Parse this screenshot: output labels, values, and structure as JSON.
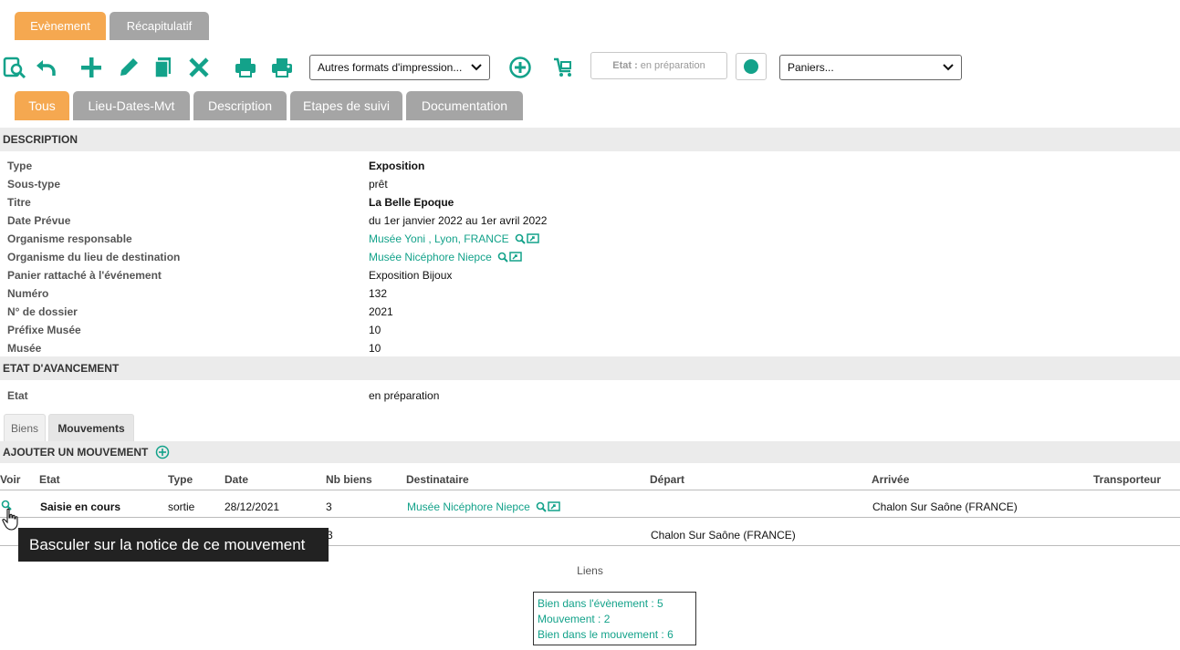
{
  "top_tabs": [
    "Evènement",
    "Récapitulatif"
  ],
  "toolbar": {
    "print_formats": "Autres formats d'impression...",
    "etat_label": "Etat :",
    "etat_value": "en préparation",
    "paniers": "Paniers..."
  },
  "sub_tabs": [
    "Tous",
    "Lieu-Dates-Mvt",
    "Description",
    "Etapes de suivi",
    "Documentation"
  ],
  "description": {
    "title": "DESCRIPTION",
    "fields": [
      {
        "label": "Type",
        "value": "Exposition"
      },
      {
        "label": "Sous-type",
        "value": "prêt"
      },
      {
        "label": "Titre",
        "value": "La Belle Epoque"
      },
      {
        "label": "Date Prévue",
        "value": "du 1er janvier 2022 au 1er avril 2022"
      },
      {
        "label": "Organisme responsable",
        "value": "Musée Yoni , Lyon, FRANCE"
      },
      {
        "label": "Organisme du lieu de destination",
        "value": "Musée Nicéphore Niepce"
      },
      {
        "label": "Panier rattaché à l'événement",
        "value": "Exposition Bijoux"
      },
      {
        "label": "Numéro",
        "value": "132"
      },
      {
        "label": "N° de dossier",
        "value": "2021"
      },
      {
        "label": "Préfixe Musée",
        "value": "10"
      },
      {
        "label": "Musée",
        "value": "10"
      }
    ]
  },
  "etat_section": {
    "title": "ETAT D'AVANCEMENT",
    "label": "Etat",
    "value": "en préparation"
  },
  "lower_tabs": [
    "Biens",
    "Mouvements"
  ],
  "mouvements": {
    "add_label": "AJOUTER UN MOUVEMENT",
    "columns": [
      "Voir",
      "Etat",
      "Type",
      "Date",
      "Nb biens",
      "Destinataire",
      "Départ",
      "Arrivée",
      "Transporteur"
    ],
    "rows": [
      {
        "etat": "Saisie en cours",
        "type": "sortie",
        "date": "28/12/2021",
        "nb": "3",
        "destinataire": "Musée Nicéphore Niepce",
        "depart": "",
        "arrivee": "Chalon Sur Saône (FRANCE)",
        "transporteur": ""
      },
      {
        "etat": "",
        "type": "",
        "date": "",
        "nb": "3",
        "destinataire": "",
        "depart": "Chalon Sur Saône (FRANCE)",
        "arrivee": "",
        "transporteur": ""
      }
    ]
  },
  "tooltip": "Basculer sur la notice de ce mouvement",
  "liens": {
    "title": "Liens",
    "items": [
      "Bien dans l'évènement : 5",
      "Mouvement : 2",
      "Bien dans le mouvement : 6"
    ]
  },
  "colors": {
    "accent": "#13a28a",
    "tab_active": "#f5a850",
    "tab_inactive": "#a5a5a5"
  }
}
